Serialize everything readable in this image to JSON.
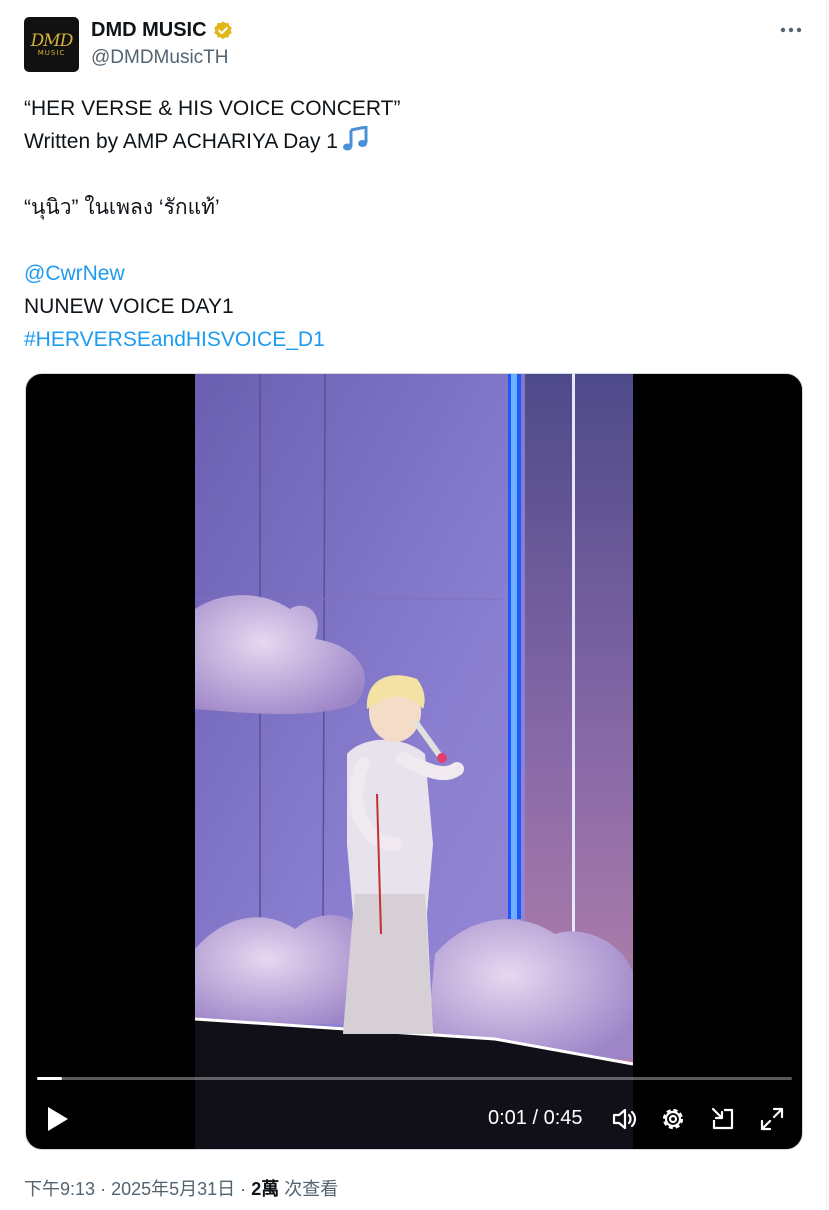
{
  "author": {
    "display_name": "DMD MUSIC",
    "handle": "@DMDMusicTH",
    "avatar_logo_top": "DMD",
    "avatar_logo_bottom": "MUSIC",
    "verified": true
  },
  "tweet": {
    "line1": "“HER VERSE & HIS VOICE CONCERT”",
    "line2": "Written by AMP ACHARIYA Day 1",
    "line2_emoji": "musical-notes",
    "line3": "“นุนิว” ในเพลง ‘รักแท้’",
    "mention": "@CwrNew",
    "line5": "NUNEW VOICE DAY1",
    "hashtag": "#HERVERSEandHISVOICE_D1"
  },
  "video": {
    "current_time": "0:01",
    "separator": "/",
    "duration": "0:45",
    "progress_fraction": 0.033
  },
  "footer": {
    "time": "下午9:13",
    "dot": "·",
    "date": "2025年5月31日",
    "views_count": "2萬",
    "views_label": "次查看"
  },
  "colors": {
    "link": "#1d9bf0",
    "secondary_text": "#536471",
    "verified_gold": "#e2b719",
    "primary_text": "#0f1419"
  },
  "icons": [
    "more-icon",
    "verified-badge-icon",
    "musical-notes-icon",
    "play-icon",
    "volume-icon",
    "settings-icon",
    "pop-out-icon",
    "fullscreen-icon"
  ]
}
